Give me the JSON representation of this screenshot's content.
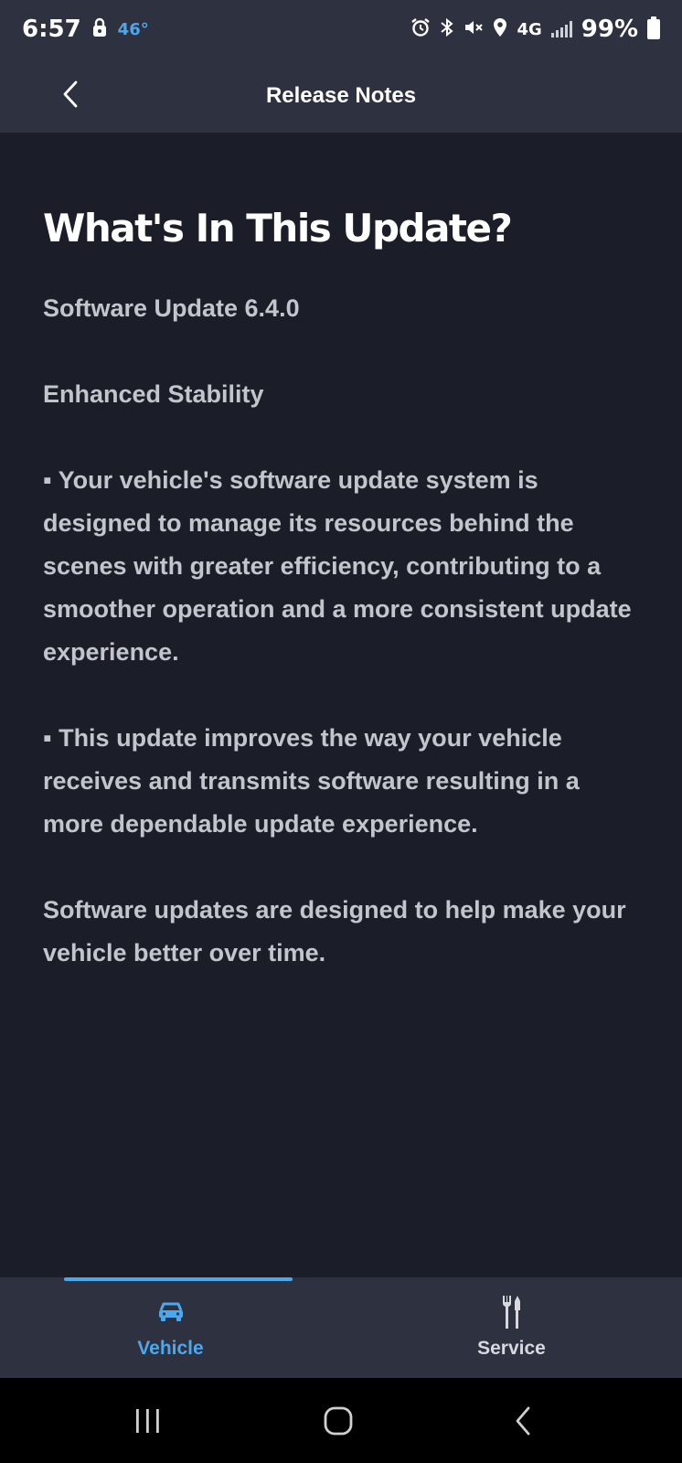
{
  "status_bar": {
    "time": "6:57",
    "temperature": "46°",
    "network": "4G",
    "battery": "99%"
  },
  "header": {
    "title": "Release Notes"
  },
  "content": {
    "title": "What's In This Update?",
    "paragraphs": [
      "Software Update 6.4.0",
      "Enhanced Stability",
      "▪ Your vehicle's software update system is designed to manage its resources behind the scenes with greater efficiency, contributing to a smoother operation and a more consistent update experience.",
      "▪ This update improves the way your vehicle receives and transmits software resulting in a more dependable update experience.",
      "Software updates are designed to help make your vehicle better over time."
    ]
  },
  "bottom_nav": {
    "tabs": [
      {
        "label": "Vehicle",
        "icon": "car-icon",
        "selected": true
      },
      {
        "label": "Service",
        "icon": "tools-icon",
        "selected": false
      }
    ]
  },
  "colors": {
    "accent": "#4aa8ef",
    "background": "#1b1d28",
    "bar": "#2e313f",
    "text": "#c3c5cc"
  }
}
